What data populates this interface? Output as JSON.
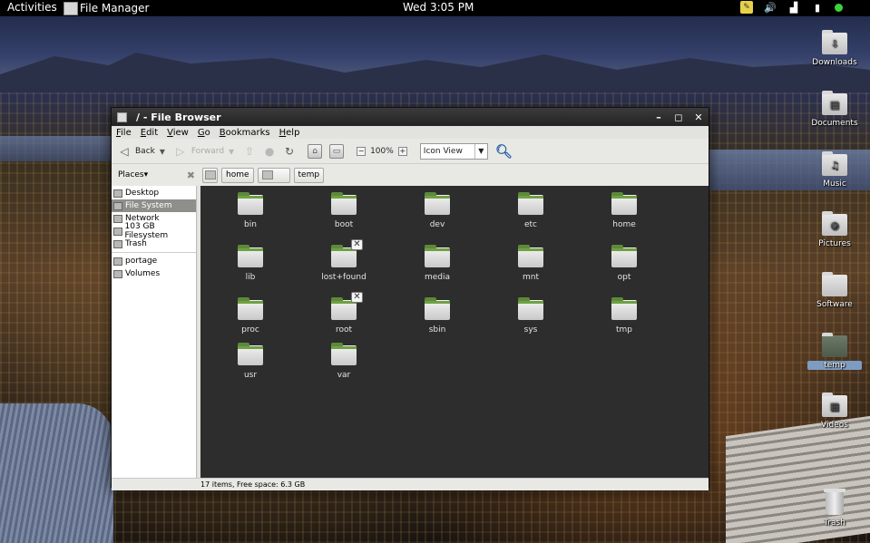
{
  "top_panel": {
    "activities": "Activities",
    "app_name": "File Manager",
    "clock": "Wed  3:05 PM"
  },
  "desktop_icons": [
    {
      "label": "Downloads",
      "icon": "download-arrow"
    },
    {
      "label": "Documents",
      "icon": "document"
    },
    {
      "label": "Music",
      "icon": "music-note"
    },
    {
      "label": "Pictures",
      "icon": "camera"
    },
    {
      "label": "Software",
      "icon": "folder"
    },
    {
      "label": "temp",
      "icon": "folder",
      "selected": true
    },
    {
      "label": "Videos",
      "icon": "film"
    },
    {
      "label": "Trash",
      "icon": "trash"
    }
  ],
  "window": {
    "title": "/ - File Browser",
    "menu": [
      "File",
      "Edit",
      "View",
      "Go",
      "Bookmarks",
      "Help"
    ],
    "toolbar": {
      "back": "Back",
      "forward": "Forward",
      "zoom": "100%",
      "view_mode": "Icon View"
    },
    "places_label": "Places",
    "pathbar": [
      "home",
      "",
      "temp"
    ],
    "sidebar": [
      "Desktop",
      "File System",
      "Network",
      "103 GB Filesystem",
      "Trash",
      "portage",
      "Volumes"
    ],
    "files": [
      "bin",
      "boot",
      "dev",
      "etc",
      "home",
      "lib",
      "lost+found",
      "media",
      "mnt",
      "opt",
      "proc",
      "root",
      "sbin",
      "sys",
      "tmp",
      "usr",
      "var"
    ],
    "status": "17 items, Free space: 6.3 GB"
  }
}
